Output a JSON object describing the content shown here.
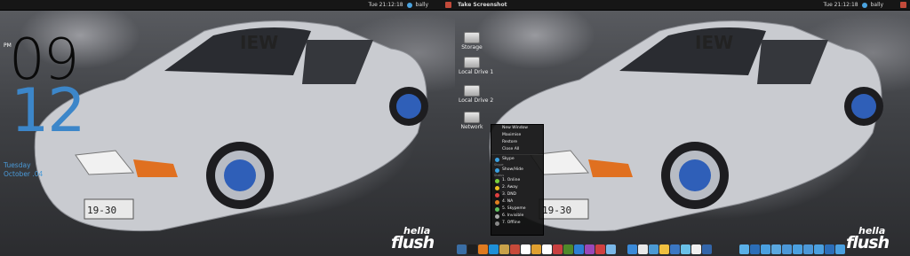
{
  "left_screen": {
    "panel": {
      "clock": "Tue 21:12:18",
      "user": "bally"
    },
    "clock_widget": {
      "meridiem": "PM",
      "hour": "09",
      "minute": "12",
      "day": "Tuesday",
      "date": "October .04"
    },
    "logo": {
      "line1": "hella",
      "line2": "flush"
    }
  },
  "right_screen": {
    "panel": {
      "title": "Take Screenshot",
      "clock": "Tue 21:12:18",
      "user": "bally"
    },
    "desktop_icons": [
      {
        "label": "Storage"
      },
      {
        "label": "Local Drive 1"
      },
      {
        "label": "Local Drive 2"
      },
      {
        "label": "Network"
      }
    ],
    "context_menu": {
      "window_items": [
        "New Window",
        "Maximise",
        "Restore",
        "Close All"
      ],
      "app_item": "Skype",
      "section_1": "Skype",
      "show_hide": "Show/Hide",
      "section_2": "Status",
      "statuses": [
        {
          "label": "1. Online",
          "color": "#7bd03d"
        },
        {
          "label": "2. Away",
          "color": "#f0c020"
        },
        {
          "label": "3. DND",
          "color": "#e04040"
        },
        {
          "label": "4. NA",
          "color": "#e08020"
        },
        {
          "label": "5. Skypeme",
          "color": "#60c060"
        },
        {
          "label": "6. Invisible",
          "color": "#aaaaaa"
        },
        {
          "label": "7. Offline",
          "color": "#888888"
        }
      ]
    },
    "logo": {
      "line1": "hella",
      "line2": "flush"
    }
  },
  "dock_colors": [
    "#3a6ea5",
    "#1f1f1f",
    "#e07a1f",
    "#1e90d8",
    "#c9a24a",
    "#c74a3a",
    "#ffffff",
    "#e0a030",
    "#ffffff",
    "#c94040",
    "#4f8a2a",
    "#2c7fd3",
    "#9a48b8",
    "#d04040",
    "#7ab8e8",
    "#2d2d2d",
    "#3a8ad8",
    "#e9e9e9",
    "#4b9ad4",
    "#f0c040",
    "#3b78c3",
    "#6ac0e8",
    "#f0f0f0",
    "#3366aa"
  ],
  "right_dock_colors": [
    "#5ab0e8",
    "#2b6eb8",
    "#4aa0e0",
    "#5aa8e0",
    "#4b98d8",
    "#4aa0e0",
    "#4b98d8",
    "#4aa0e0",
    "#2b6eb8",
    "#4aa0e0"
  ]
}
